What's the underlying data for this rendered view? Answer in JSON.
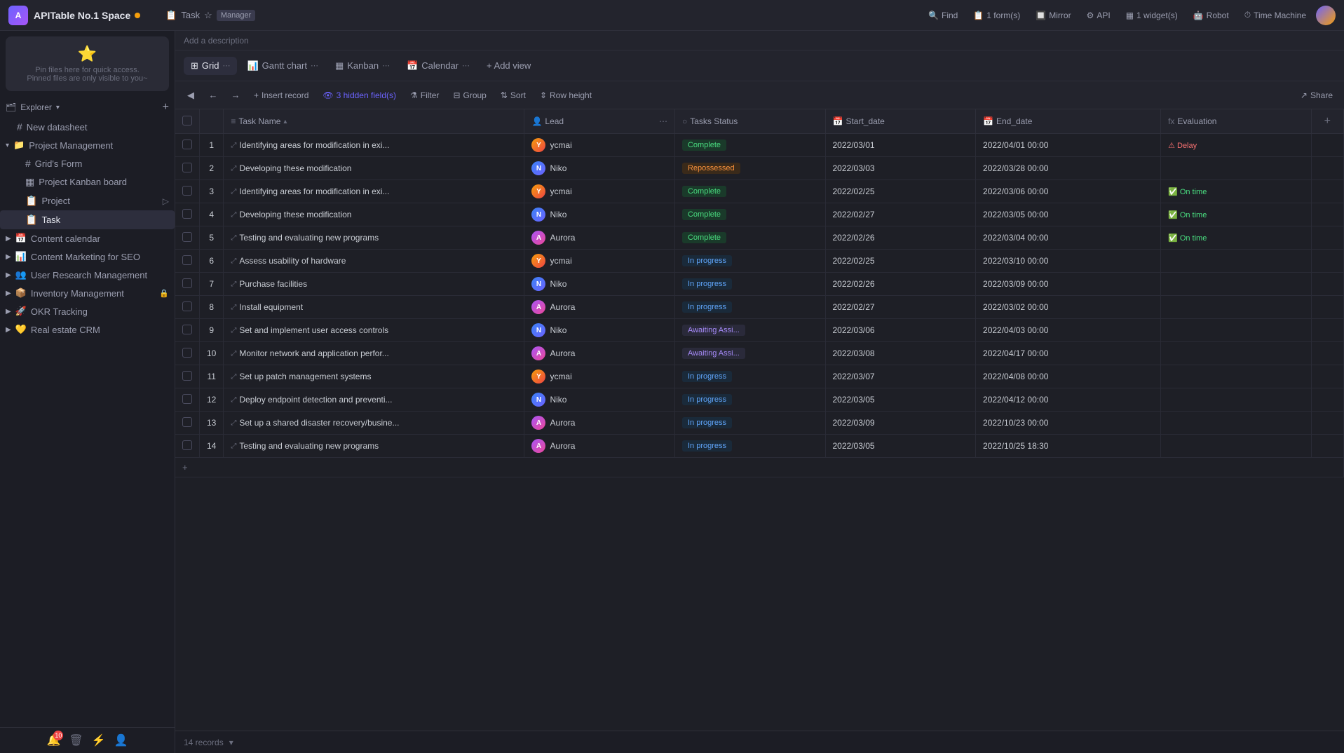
{
  "app": {
    "title": "APITable No.1 Space",
    "status_dot_color": "#f59e0b"
  },
  "top_bar": {
    "task_label": "Task",
    "manager_tag": "Manager",
    "add_description": "Add a description",
    "find_btn": "Find",
    "form_btn": "1 form(s)",
    "mirror_btn": "Mirror",
    "api_btn": "API",
    "widget_btn": "1 widget(s)",
    "robot_btn": "Robot",
    "time_machine_btn": "Time Machine"
  },
  "views": {
    "grid": "Grid",
    "gantt": "Gantt chart",
    "kanban": "Kanban",
    "calendar": "Calendar",
    "add_view": "+ Add view"
  },
  "action_bar": {
    "hidden_fields": "3 hidden field(s)",
    "filter": "Filter",
    "group": "Group",
    "sort": "Sort",
    "row_height": "Row height",
    "share": "Share"
  },
  "sidebar": {
    "explorer_label": "Explorer",
    "new_datasheet": "New datasheet",
    "project_management": "Project Management",
    "grids_form": "Grid's Form",
    "project_kanban": "Project Kanban board",
    "project": "Project",
    "task": "Task",
    "content_calendar": "Content calendar",
    "content_marketing": "Content Marketing for SEO",
    "user_research": "User Research Management",
    "inventory_management": "Inventory Management",
    "okr_tracking": "OKR Tracking",
    "real_estate": "Real estate CRM"
  },
  "table": {
    "columns": [
      {
        "id": "task_name",
        "label": "Task Name",
        "icon": "≡"
      },
      {
        "id": "lead",
        "label": "Lead",
        "icon": "👤"
      },
      {
        "id": "tasks_status",
        "label": "Tasks Status",
        "icon": "○"
      },
      {
        "id": "start_date",
        "label": "Start_date",
        "icon": "📅"
      },
      {
        "id": "end_date",
        "label": "End_date",
        "icon": "📅"
      },
      {
        "id": "evaluation",
        "label": "Evaluation",
        "icon": "fx"
      }
    ],
    "rows": [
      {
        "num": 1,
        "task": "Identifying areas for modification in exi...",
        "lead": "ycmai",
        "lead_type": "ycmai",
        "status": "Complete",
        "status_type": "complete",
        "start": "2022/03/01",
        "end": "2022/04/01 00:00",
        "eval": "⚠ Delay",
        "eval_type": "delay"
      },
      {
        "num": 2,
        "task": "Developing these modification",
        "lead": "Niko",
        "lead_type": "niko",
        "status": "Repossessed",
        "status_type": "repossessed",
        "start": "2022/03/03",
        "end": "2022/03/28 00:00",
        "eval": "",
        "eval_type": ""
      },
      {
        "num": 3,
        "task": "Identifying areas for modification in exi...",
        "lead": "ycmai",
        "lead_type": "ycmai",
        "status": "Complete",
        "status_type": "complete",
        "start": "2022/02/25",
        "end": "2022/03/06 00:00",
        "eval": "✅ On time",
        "eval_type": "ontime"
      },
      {
        "num": 4,
        "task": "Developing these modification",
        "lead": "Niko",
        "lead_type": "niko",
        "status": "Complete",
        "status_type": "complete",
        "start": "2022/02/27",
        "end": "2022/03/05 00:00",
        "eval": "✅ On time",
        "eval_type": "ontime"
      },
      {
        "num": 5,
        "task": "Testing and evaluating new programs",
        "lead": "Aurora",
        "lead_type": "aurora",
        "status": "Complete",
        "status_type": "complete",
        "start": "2022/02/26",
        "end": "2022/03/04 00:00",
        "eval": "✅ On time",
        "eval_type": "ontime"
      },
      {
        "num": 6,
        "task": "Assess usability of hardware",
        "lead": "ycmai",
        "lead_type": "ycmai",
        "status": "In progress",
        "status_type": "in-progress",
        "start": "2022/02/25",
        "end": "2022/03/10 00:00",
        "eval": "",
        "eval_type": ""
      },
      {
        "num": 7,
        "task": "Purchase facilities",
        "lead": "Niko",
        "lead_type": "niko",
        "status": "In progress",
        "status_type": "in-progress",
        "start": "2022/02/26",
        "end": "2022/03/09 00:00",
        "eval": "",
        "eval_type": ""
      },
      {
        "num": 8,
        "task": "Install equipment",
        "lead": "Aurora",
        "lead_type": "aurora",
        "status": "In progress",
        "status_type": "in-progress",
        "start": "2022/02/27",
        "end": "2022/03/02 00:00",
        "eval": "",
        "eval_type": ""
      },
      {
        "num": 9,
        "task": "Set and implement user access controls",
        "lead": "Niko",
        "lead_type": "niko",
        "status": "Awaiting Assi...",
        "status_type": "awaiting",
        "start": "2022/03/06",
        "end": "2022/04/03 00:00",
        "eval": "",
        "eval_type": ""
      },
      {
        "num": 10,
        "task": "Monitor network and application perfor...",
        "lead": "Aurora",
        "lead_type": "aurora",
        "status": "Awaiting Assi...",
        "status_type": "awaiting",
        "start": "2022/03/08",
        "end": "2022/04/17 00:00",
        "eval": "",
        "eval_type": ""
      },
      {
        "num": 11,
        "task": "Set up patch management systems",
        "lead": "ycmai",
        "lead_type": "ycmai",
        "status": "In progress",
        "status_type": "in-progress",
        "start": "2022/03/07",
        "end": "2022/04/08 00:00",
        "eval": "",
        "eval_type": ""
      },
      {
        "num": 12,
        "task": "Deploy endpoint detection and preventi...",
        "lead": "Niko",
        "lead_type": "niko",
        "status": "In progress",
        "status_type": "in-progress",
        "start": "2022/03/05",
        "end": "2022/04/12 00:00",
        "eval": "",
        "eval_type": ""
      },
      {
        "num": 13,
        "task": "Set up a shared disaster recovery/busine...",
        "lead": "Aurora",
        "lead_type": "aurora",
        "status": "In progress",
        "status_type": "in-progress",
        "start": "2022/03/09",
        "end": "2022/10/23 00:00",
        "eval": "",
        "eval_type": ""
      },
      {
        "num": 14,
        "task": "Testing and evaluating new programs",
        "lead": "Aurora",
        "lead_type": "aurora",
        "status": "In progress",
        "status_type": "in-progress",
        "start": "2022/03/05",
        "end": "2022/10/25 18:30",
        "eval": "",
        "eval_type": ""
      }
    ],
    "record_count": "14 records"
  }
}
